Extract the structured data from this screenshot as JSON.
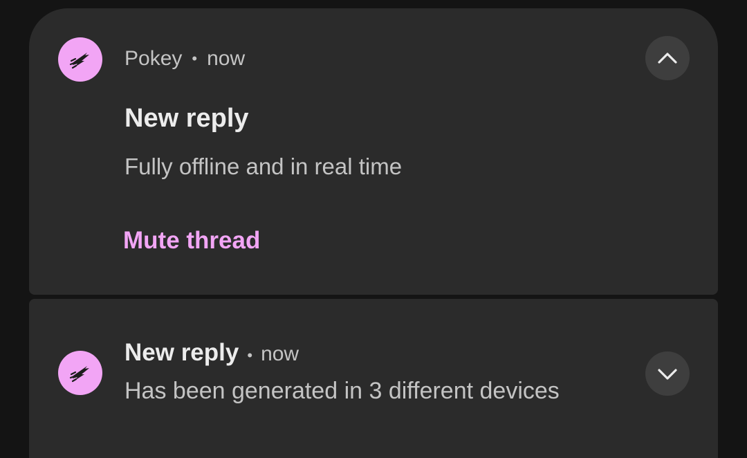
{
  "notifications": {
    "expanded": {
      "app_name": "Pokey",
      "separator": "•",
      "time": "now",
      "title": "New reply",
      "text": "Fully offline and in real time",
      "action_label": "Mute thread",
      "toggle_icon": "chevron-up-icon"
    },
    "collapsed": {
      "title": "New reply",
      "separator": "•",
      "time": "now",
      "text": "Has been generated in 3 different devices",
      "toggle_icon": "chevron-down-icon"
    }
  },
  "colors": {
    "background": "#141414",
    "card": "#2b2b2b",
    "accent": "#f2a5f5",
    "button": "#3e3e3e",
    "primary_text": "#ececec",
    "secondary_text": "#c4c4c4"
  },
  "icons": {
    "app_icon": "pokey-app-icon"
  }
}
